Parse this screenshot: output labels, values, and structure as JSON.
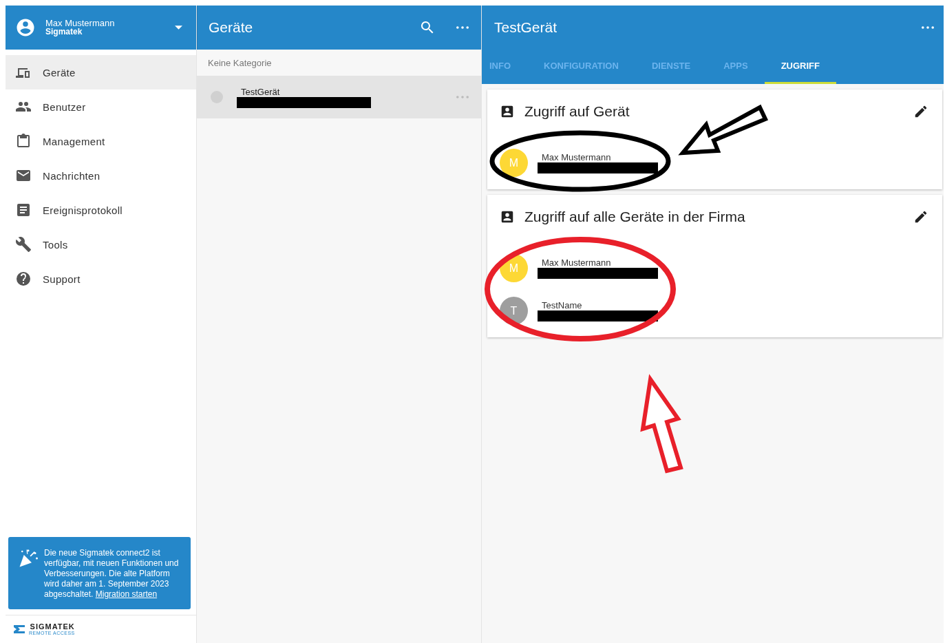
{
  "account": {
    "name": "Max Mustermann",
    "company": "Sigmatek"
  },
  "nav": [
    {
      "label": "Geräte",
      "selected": true
    },
    {
      "label": "Benutzer",
      "selected": false
    },
    {
      "label": "Management",
      "selected": false
    },
    {
      "label": "Nachrichten",
      "selected": false
    },
    {
      "label": "Ereignisprotokoll",
      "selected": false
    },
    {
      "label": "Tools",
      "selected": false
    },
    {
      "label": "Support",
      "selected": false
    }
  ],
  "banner": {
    "text": "Die neue Sigmatek connect2 ist verfügbar, mit neuen Funktionen und Verbesserungen. Die alte Platform wird daher am 1. September 2023 abgeschaltet.",
    "link": "Migration starten"
  },
  "logo": {
    "name": "SIGMATEK",
    "tagline": "REMOTE ACCESS"
  },
  "devices": {
    "title": "Geräte",
    "category": "Keine Kategorie",
    "items": [
      {
        "name": "TestGerät",
        "selected": true
      }
    ]
  },
  "detail": {
    "title": "TestGerät",
    "tabs": [
      {
        "label": "INFO",
        "selected": false
      },
      {
        "label": "KONFIGURATION",
        "selected": false
      },
      {
        "label": "DIENSTE",
        "selected": false
      },
      {
        "label": "APPS",
        "selected": false
      },
      {
        "label": "ZUGRIFF",
        "selected": true
      }
    ],
    "sections": [
      {
        "title": "Zugriff auf Gerät",
        "users": [
          {
            "name": "Max Mustermann",
            "initial": "M",
            "color": "#fdd835"
          }
        ]
      },
      {
        "title": "Zugriff auf alle Geräte in der Firma",
        "users": [
          {
            "name": "Max Mustermann",
            "initial": "M",
            "color": "#fdd835"
          },
          {
            "name": "TestName",
            "initial": "T",
            "color": "#9e9e9e"
          }
        ]
      }
    ]
  }
}
